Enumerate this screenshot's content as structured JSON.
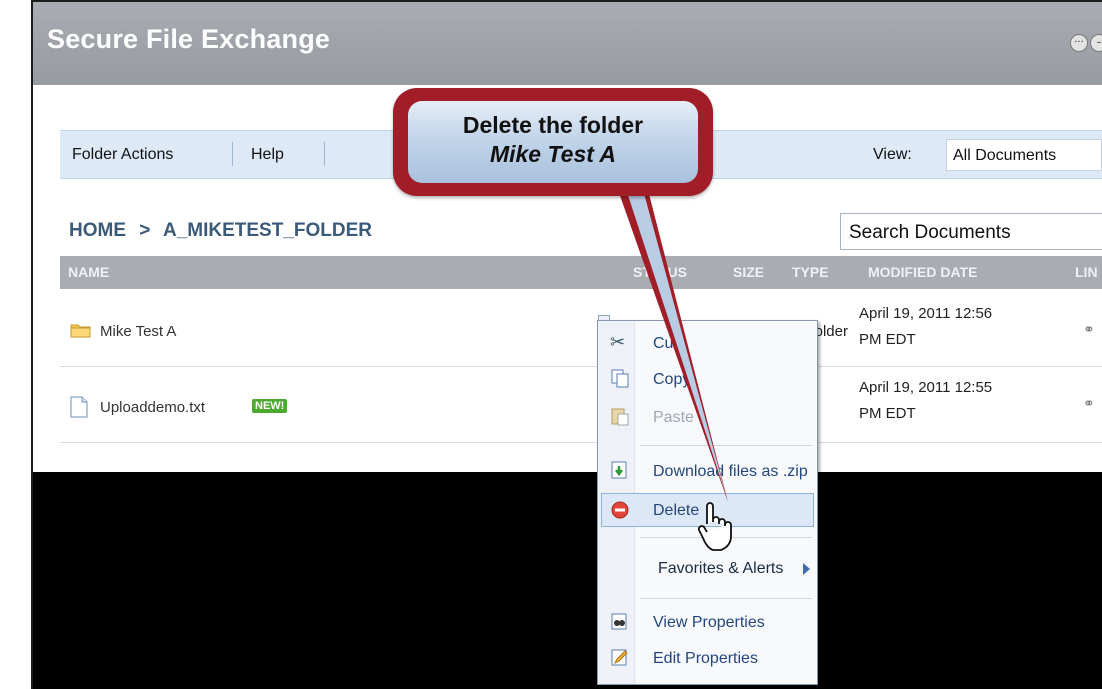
{
  "window": {
    "title": "Secure File Exchange",
    "buttons": [
      "···",
      "–"
    ]
  },
  "toolbar": {
    "folder_actions": "Folder Actions",
    "help": "Help",
    "view_label": "View:",
    "view_value": "All Documents"
  },
  "breadcrumb": {
    "home": "HOME",
    "separator": ">",
    "folder": "A_MIKETEST_FOLDER"
  },
  "search": {
    "placeholder": "Search Documents"
  },
  "table": {
    "columns": {
      "name": "NAME",
      "status": "STATUS",
      "size": "SIZE",
      "type": "TYPE",
      "modified": "MODIFIED DATE",
      "link": "LIN"
    },
    "rows": [
      {
        "icon": "folder-icon",
        "name": "Mike Test A",
        "type": "Folder",
        "date_line1": "April 19, 2011 12:56",
        "date_line2": "PM EDT"
      },
      {
        "icon": "text-file-icon",
        "name": "Uploaddemo.txt",
        "badge": "NEW!",
        "date_line1": "April 19, 2011 12:55",
        "date_line2": "PM EDT"
      }
    ]
  },
  "context_menu": {
    "items": [
      {
        "label": "Cut",
        "icon": "scissors-icon",
        "state": "enabled"
      },
      {
        "label": "Copy",
        "icon": "copy-icon",
        "state": "enabled"
      },
      {
        "label": "Paste",
        "icon": "paste-icon",
        "state": "disabled"
      },
      {
        "label": "Download files as .zip",
        "icon": "download-icon",
        "state": "enabled"
      },
      {
        "label": "Delete",
        "icon": "delete-icon",
        "state": "selected"
      },
      {
        "label": "Favorites & Alerts",
        "icon": "",
        "state": "submenu"
      },
      {
        "label": "View Properties",
        "icon": "binoculars-icon",
        "state": "enabled"
      },
      {
        "label": "Edit Properties",
        "icon": "edit-icon",
        "state": "enabled"
      }
    ]
  },
  "callout": {
    "line1": "Delete the folder",
    "line2": "Mike Test A"
  },
  "colors": {
    "titlebar": "#a3a7ad",
    "toolbar": "#dde9f6",
    "callout_border": "#a11e28",
    "menu_text": "#23467e",
    "new_badge": "#4caa30"
  }
}
